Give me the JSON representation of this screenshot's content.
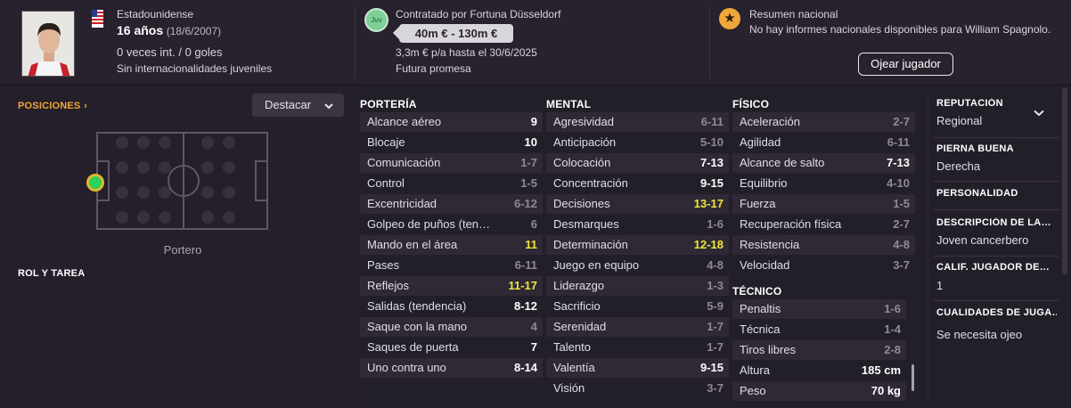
{
  "header": {
    "nationality": "Estadounidense",
    "age": "16 años",
    "birthdate": "(18/6/2007)",
    "caps": "0 veces int. / 0 goles",
    "youth": "Sin internacionalidades juveniles",
    "contract": "Contratado por Fortuna Düsseldorf",
    "club_badge": "Juv",
    "value": "40m € - 130m €",
    "wage": "3,3m € p/a hasta el 30/6/2025",
    "potential": "Futura promesa",
    "national_title": "Resumen nacional",
    "national_text": "No hay informes nacionales disponibles para William Spagnolo.",
    "scout_button": "Ojear jugador"
  },
  "left": {
    "positions_label": "POSICIONES",
    "positions_chevron": "›",
    "highlight_select": "Destacar",
    "position_name": "Portero",
    "role_label": "ROL Y TAREA"
  },
  "colors": {
    "accent": "#f0a63a",
    "highlight": "#f2e63c",
    "position_dot": "#2ed15c"
  },
  "porteria": {
    "title": "PORTERÍA",
    "rows": [
      {
        "name": "Alcance aéreo",
        "value": "9",
        "tone": "wh"
      },
      {
        "name": "Blocaje",
        "value": "10",
        "tone": "wh"
      },
      {
        "name": "Comunicación",
        "value": "1-7",
        "tone": "dim"
      },
      {
        "name": "Control",
        "value": "1-5",
        "tone": "dim"
      },
      {
        "name": "Excentricidad",
        "value": "6-12",
        "tone": "dim"
      },
      {
        "name": "Golpeo de puños (ten…",
        "value": "6",
        "tone": "dim"
      },
      {
        "name": "Mando en el área",
        "value": "11",
        "tone": "yl"
      },
      {
        "name": "Pases",
        "value": "6-11",
        "tone": "dim"
      },
      {
        "name": "Reflejos",
        "value": "11-17",
        "tone": "yl"
      },
      {
        "name": "Salidas (tendencia)",
        "value": "8-12",
        "tone": "wh"
      },
      {
        "name": "Saque con la mano",
        "value": "4",
        "tone": "dim"
      },
      {
        "name": "Saques de puerta",
        "value": "7",
        "tone": "wh"
      },
      {
        "name": "Uno contra uno",
        "value": "8-14",
        "tone": "wh"
      }
    ]
  },
  "mental": {
    "title": "MENTAL",
    "rows": [
      {
        "name": "Agresividad",
        "value": "6-11",
        "tone": "dim"
      },
      {
        "name": "Anticipación",
        "value": "5-10",
        "tone": "dim"
      },
      {
        "name": "Colocación",
        "value": "7-13",
        "tone": "wh"
      },
      {
        "name": "Concentración",
        "value": "9-15",
        "tone": "wh"
      },
      {
        "name": "Decisiones",
        "value": "13-17",
        "tone": "yl"
      },
      {
        "name": "Desmarques",
        "value": "1-6",
        "tone": "dim"
      },
      {
        "name": "Determinación",
        "value": "12-18",
        "tone": "yl"
      },
      {
        "name": "Juego en equipo",
        "value": "4-8",
        "tone": "dim"
      },
      {
        "name": "Liderazgo",
        "value": "1-3",
        "tone": "dim"
      },
      {
        "name": "Sacrificio",
        "value": "5-9",
        "tone": "dim"
      },
      {
        "name": "Serenidad",
        "value": "1-7",
        "tone": "dim"
      },
      {
        "name": "Talento",
        "value": "1-7",
        "tone": "dim"
      },
      {
        "name": "Valentía",
        "value": "9-15",
        "tone": "wh"
      },
      {
        "name": "Visión",
        "value": "3-7",
        "tone": "dim"
      }
    ]
  },
  "fisico": {
    "title": "FÍSICO",
    "rows": [
      {
        "name": "Aceleración",
        "value": "2-7",
        "tone": "dim"
      },
      {
        "name": "Agilidad",
        "value": "6-11",
        "tone": "dim"
      },
      {
        "name": "Alcance de salto",
        "value": "7-13",
        "tone": "wh"
      },
      {
        "name": "Equilibrio",
        "value": "4-10",
        "tone": "dim"
      },
      {
        "name": "Fuerza",
        "value": "1-5",
        "tone": "dim"
      },
      {
        "name": "Recuperación física",
        "value": "2-7",
        "tone": "dim"
      },
      {
        "name": "Resistencia",
        "value": "4-8",
        "tone": "dim"
      },
      {
        "name": "Velocidad",
        "value": "3-7",
        "tone": "dim"
      }
    ]
  },
  "tecnico": {
    "title": "TÉCNICO",
    "rows": [
      {
        "name": "Penaltis",
        "value": "1-6",
        "tone": "dim"
      },
      {
        "name": "Técnica",
        "value": "1-4",
        "tone": "dim"
      },
      {
        "name": "Tiros libres",
        "value": "2-8",
        "tone": "dim"
      },
      {
        "name": "Altura",
        "value": "185 cm",
        "tone": "wh"
      },
      {
        "name": "Peso",
        "value": "70 kg",
        "tone": "wh"
      }
    ]
  },
  "info": {
    "reputation_label": "REPUTACIÓN",
    "reputation_value": "Regional",
    "foot_label": "PIERNA BUENA",
    "foot_value": "Derecha",
    "personality_label": "PERSONALIDAD",
    "description_label": "DESCRIPCIÓN DE LA…",
    "description_value": "Joven cancerbero",
    "rating_label": "CALIF. JUGADOR DE…",
    "rating_value": "1",
    "qualities_label": "CUALIDADES DE JUGA…",
    "qualities_value": "Se necesita ojeo"
  }
}
